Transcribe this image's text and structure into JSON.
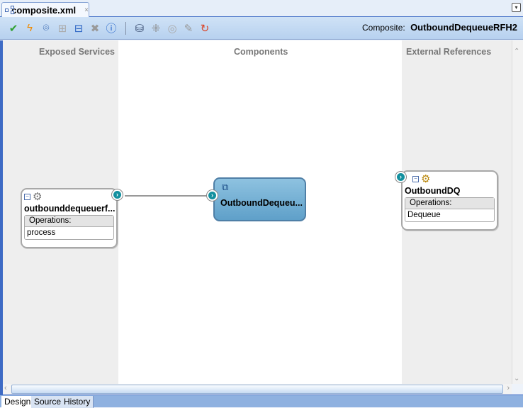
{
  "editor_tab": {
    "title": "composite.xml",
    "close": "×"
  },
  "tab_menu_icon": "▾",
  "toolbar": {
    "buttons": [
      {
        "name": "validate-icon",
        "glyph": "✔",
        "color": "#2fa02f"
      },
      {
        "name": "lightning-icon",
        "glyph": "ϟ",
        "color": "#f08a00"
      },
      {
        "name": "antenna-icon",
        "glyph": "⌾",
        "color": "#2357a8"
      },
      {
        "name": "add-icon",
        "glyph": "⊞",
        "color": "#aaaaaa"
      },
      {
        "name": "remove-icon",
        "glyph": "⊟",
        "color": "#2d66c4"
      },
      {
        "name": "delete-icon",
        "glyph": "✖",
        "color": "#999999"
      },
      {
        "name": "info-icon",
        "glyph": "ⓘ",
        "color": "#1d5fc8"
      },
      {
        "name": "database-icon",
        "glyph": "⛁",
        "color": "#3c4f73"
      },
      {
        "name": "network-icon",
        "glyph": "⁜",
        "color": "#888888"
      },
      {
        "name": "disk-icon",
        "glyph": "◎",
        "color": "#aaaaaa"
      },
      {
        "name": "edit-icon",
        "glyph": "✎",
        "color": "#999999"
      },
      {
        "name": "deploy-icon",
        "glyph": "↻",
        "color": "#d9472b"
      }
    ],
    "composite_label": "Composite:",
    "composite_name": "OutboundDequeueRFH2"
  },
  "lanes": {
    "left": "Exposed Services",
    "center": "Components",
    "right": "External References"
  },
  "service": {
    "name": "outbounddequeuerf...",
    "ops_label": "Operations:",
    "ops": [
      "process"
    ]
  },
  "component": {
    "name": "OutboundDequeu..."
  },
  "reference": {
    "name": "OutboundDQ",
    "ops_label": "Operations:",
    "ops": [
      "Dequeue"
    ]
  },
  "bottom_tabs": [
    "Design",
    "Source",
    "History"
  ],
  "active_bottom_tab": "Design"
}
